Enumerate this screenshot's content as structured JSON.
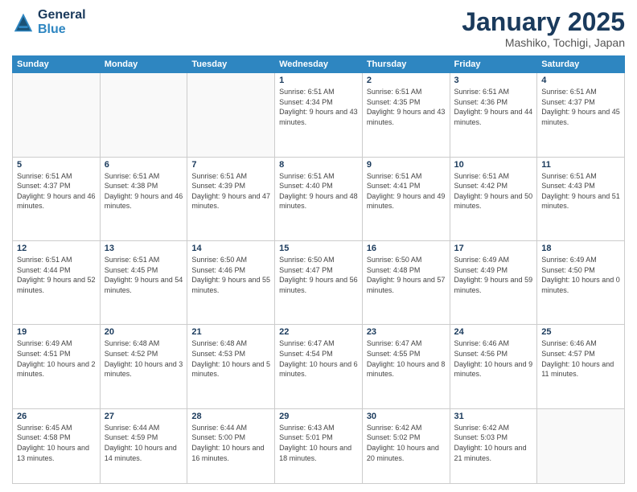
{
  "logo": {
    "line1": "General",
    "line2": "Blue"
  },
  "title": "January 2025",
  "subtitle": "Mashiko, Tochigi, Japan",
  "weekdays": [
    "Sunday",
    "Monday",
    "Tuesday",
    "Wednesday",
    "Thursday",
    "Friday",
    "Saturday"
  ],
  "weeks": [
    [
      {
        "day": "",
        "info": ""
      },
      {
        "day": "",
        "info": ""
      },
      {
        "day": "",
        "info": ""
      },
      {
        "day": "1",
        "info": "Sunrise: 6:51 AM\nSunset: 4:34 PM\nDaylight: 9 hours and 43 minutes."
      },
      {
        "day": "2",
        "info": "Sunrise: 6:51 AM\nSunset: 4:35 PM\nDaylight: 9 hours and 43 minutes."
      },
      {
        "day": "3",
        "info": "Sunrise: 6:51 AM\nSunset: 4:36 PM\nDaylight: 9 hours and 44 minutes."
      },
      {
        "day": "4",
        "info": "Sunrise: 6:51 AM\nSunset: 4:37 PM\nDaylight: 9 hours and 45 minutes."
      }
    ],
    [
      {
        "day": "5",
        "info": "Sunrise: 6:51 AM\nSunset: 4:37 PM\nDaylight: 9 hours and 46 minutes."
      },
      {
        "day": "6",
        "info": "Sunrise: 6:51 AM\nSunset: 4:38 PM\nDaylight: 9 hours and 46 minutes."
      },
      {
        "day": "7",
        "info": "Sunrise: 6:51 AM\nSunset: 4:39 PM\nDaylight: 9 hours and 47 minutes."
      },
      {
        "day": "8",
        "info": "Sunrise: 6:51 AM\nSunset: 4:40 PM\nDaylight: 9 hours and 48 minutes."
      },
      {
        "day": "9",
        "info": "Sunrise: 6:51 AM\nSunset: 4:41 PM\nDaylight: 9 hours and 49 minutes."
      },
      {
        "day": "10",
        "info": "Sunrise: 6:51 AM\nSunset: 4:42 PM\nDaylight: 9 hours and 50 minutes."
      },
      {
        "day": "11",
        "info": "Sunrise: 6:51 AM\nSunset: 4:43 PM\nDaylight: 9 hours and 51 minutes."
      }
    ],
    [
      {
        "day": "12",
        "info": "Sunrise: 6:51 AM\nSunset: 4:44 PM\nDaylight: 9 hours and 52 minutes."
      },
      {
        "day": "13",
        "info": "Sunrise: 6:51 AM\nSunset: 4:45 PM\nDaylight: 9 hours and 54 minutes."
      },
      {
        "day": "14",
        "info": "Sunrise: 6:50 AM\nSunset: 4:46 PM\nDaylight: 9 hours and 55 minutes."
      },
      {
        "day": "15",
        "info": "Sunrise: 6:50 AM\nSunset: 4:47 PM\nDaylight: 9 hours and 56 minutes."
      },
      {
        "day": "16",
        "info": "Sunrise: 6:50 AM\nSunset: 4:48 PM\nDaylight: 9 hours and 57 minutes."
      },
      {
        "day": "17",
        "info": "Sunrise: 6:49 AM\nSunset: 4:49 PM\nDaylight: 9 hours and 59 minutes."
      },
      {
        "day": "18",
        "info": "Sunrise: 6:49 AM\nSunset: 4:50 PM\nDaylight: 10 hours and 0 minutes."
      }
    ],
    [
      {
        "day": "19",
        "info": "Sunrise: 6:49 AM\nSunset: 4:51 PM\nDaylight: 10 hours and 2 minutes."
      },
      {
        "day": "20",
        "info": "Sunrise: 6:48 AM\nSunset: 4:52 PM\nDaylight: 10 hours and 3 minutes."
      },
      {
        "day": "21",
        "info": "Sunrise: 6:48 AM\nSunset: 4:53 PM\nDaylight: 10 hours and 5 minutes."
      },
      {
        "day": "22",
        "info": "Sunrise: 6:47 AM\nSunset: 4:54 PM\nDaylight: 10 hours and 6 minutes."
      },
      {
        "day": "23",
        "info": "Sunrise: 6:47 AM\nSunset: 4:55 PM\nDaylight: 10 hours and 8 minutes."
      },
      {
        "day": "24",
        "info": "Sunrise: 6:46 AM\nSunset: 4:56 PM\nDaylight: 10 hours and 9 minutes."
      },
      {
        "day": "25",
        "info": "Sunrise: 6:46 AM\nSunset: 4:57 PM\nDaylight: 10 hours and 11 minutes."
      }
    ],
    [
      {
        "day": "26",
        "info": "Sunrise: 6:45 AM\nSunset: 4:58 PM\nDaylight: 10 hours and 13 minutes."
      },
      {
        "day": "27",
        "info": "Sunrise: 6:44 AM\nSunset: 4:59 PM\nDaylight: 10 hours and 14 minutes."
      },
      {
        "day": "28",
        "info": "Sunrise: 6:44 AM\nSunset: 5:00 PM\nDaylight: 10 hours and 16 minutes."
      },
      {
        "day": "29",
        "info": "Sunrise: 6:43 AM\nSunset: 5:01 PM\nDaylight: 10 hours and 18 minutes."
      },
      {
        "day": "30",
        "info": "Sunrise: 6:42 AM\nSunset: 5:02 PM\nDaylight: 10 hours and 20 minutes."
      },
      {
        "day": "31",
        "info": "Sunrise: 6:42 AM\nSunset: 5:03 PM\nDaylight: 10 hours and 21 minutes."
      },
      {
        "day": "",
        "info": ""
      }
    ]
  ]
}
